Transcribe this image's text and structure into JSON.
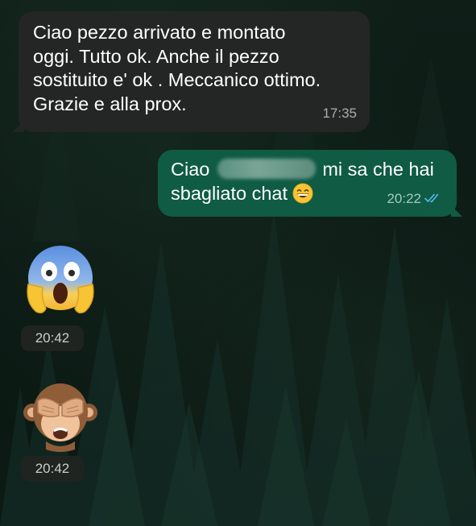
{
  "chat": {
    "messages": [
      {
        "direction": "incoming",
        "text": "Ciao pezzo arrivato e montato\noggi. Tutto ok. Anche il pezzo\nsostituito e' ok . Meccanico ottimo.\nGrazie e alla prox.",
        "time": "17:35"
      },
      {
        "direction": "outgoing",
        "text_before_redaction": "Ciao",
        "text_after_redaction": "mi sa che hai",
        "text_line2": "sbagliato chat",
        "emoji": "grinning-face-with-smiling-eyes",
        "time": "20:22",
        "status": "read"
      },
      {
        "direction": "incoming",
        "emoji": "face-screaming-in-fear",
        "time": "20:42"
      },
      {
        "direction": "incoming",
        "emoji": "see-no-evil-monkey",
        "time": "20:42"
      }
    ]
  },
  "colors": {
    "incoming_bubble": "#242626",
    "outgoing_bubble": "#0f5b44",
    "read_ticks": "#53bdeb",
    "wallpaper": "#0b1a14"
  }
}
